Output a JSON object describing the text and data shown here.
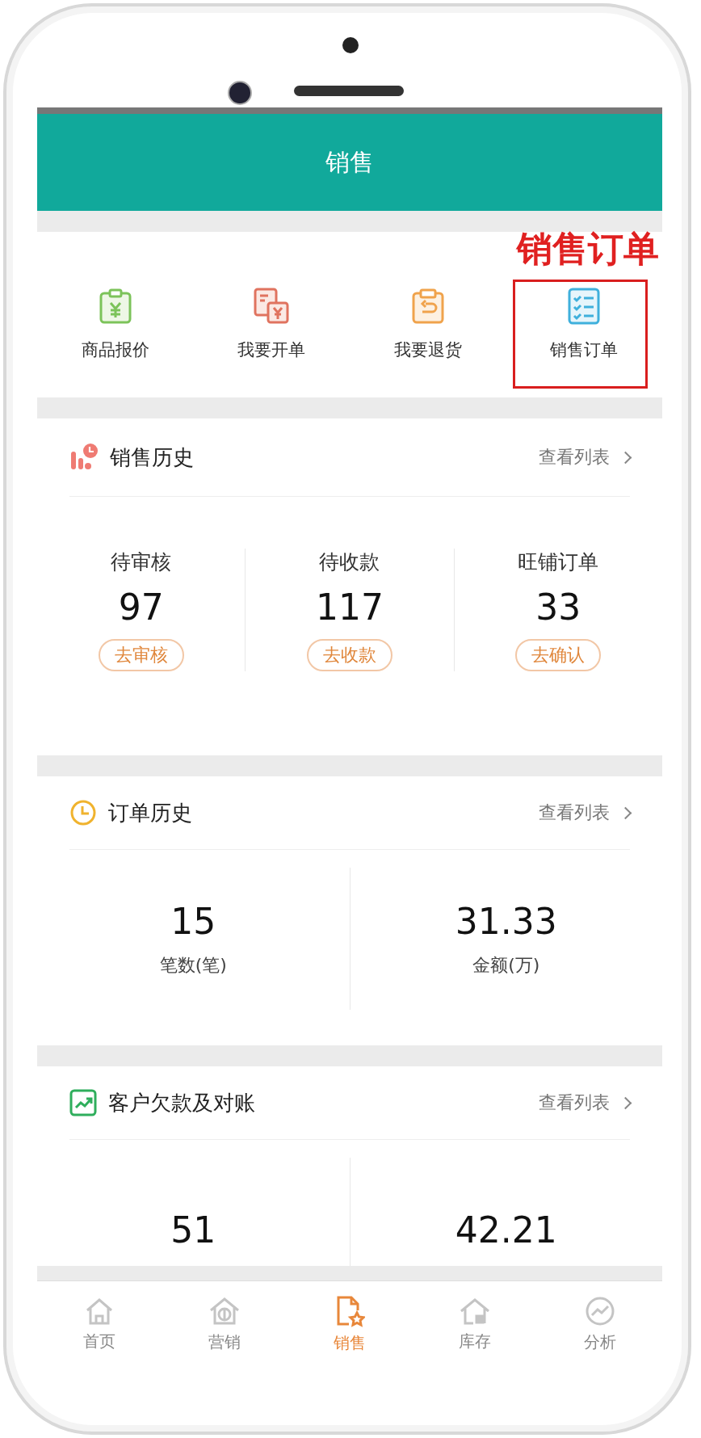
{
  "header": {
    "title": "销售"
  },
  "annotation": {
    "text": "销售订单"
  },
  "quick_actions": [
    {
      "label": "商品报价",
      "boxed": false
    },
    {
      "label": "我要开单",
      "boxed": false
    },
    {
      "label": "我要退货",
      "boxed": false
    },
    {
      "label": "销售订单",
      "boxed": true
    }
  ],
  "sections": [
    {
      "kind": "triple",
      "title": "销售历史",
      "link": "查看列表",
      "stats": [
        {
          "label": "待审核",
          "value": "97",
          "action": "去审核"
        },
        {
          "label": "待收款",
          "value": "117",
          "action": "去收款"
        },
        {
          "label": "旺铺订单",
          "value": "33",
          "action": "去确认"
        }
      ]
    },
    {
      "kind": "double",
      "title": "订单历史",
      "link": "查看列表",
      "stats": [
        {
          "value": "15",
          "label": "笔数(笔)"
        },
        {
          "value": "31.33",
          "label": "金额(万)"
        }
      ]
    },
    {
      "kind": "double_cut",
      "title": "客户欠款及对账",
      "link": "查看列表",
      "stats": [
        {
          "value": "51"
        },
        {
          "value": "42.21"
        }
      ]
    }
  ],
  "tab_bar": [
    {
      "label": "首页",
      "selected": false
    },
    {
      "label": "营销",
      "selected": false
    },
    {
      "label": "销售",
      "selected": true
    },
    {
      "label": "库存",
      "selected": false
    },
    {
      "label": "分析",
      "selected": false
    }
  ]
}
